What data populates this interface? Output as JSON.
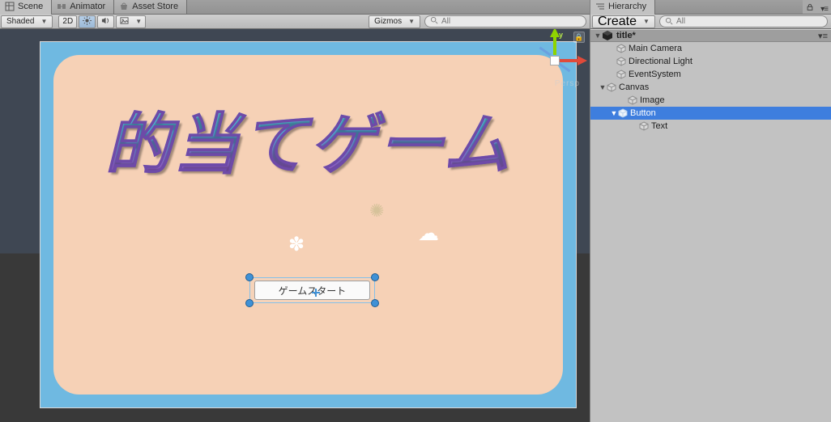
{
  "tabs": {
    "scene": "Scene",
    "animator": "Animator",
    "assetStore": "Asset Store"
  },
  "toolbar": {
    "shading": "Shaded",
    "mode2d": "2D",
    "gizmos": "Gizmos",
    "searchPlaceholder": "All"
  },
  "viewport": {
    "yLabel": "y",
    "persp": "Persp"
  },
  "game": {
    "title": "的当てゲーム",
    "buttonLabel": "ゲームスタート"
  },
  "hierarchy": {
    "tab": "Hierarchy",
    "create": "Create",
    "searchPlaceholder": "All",
    "scene": "title*",
    "nodes": {
      "mainCamera": "Main Camera",
      "dirLight": "Directional Light",
      "eventSystem": "EventSystem",
      "canvas": "Canvas",
      "image": "Image",
      "button": "Button",
      "text": "Text"
    }
  }
}
